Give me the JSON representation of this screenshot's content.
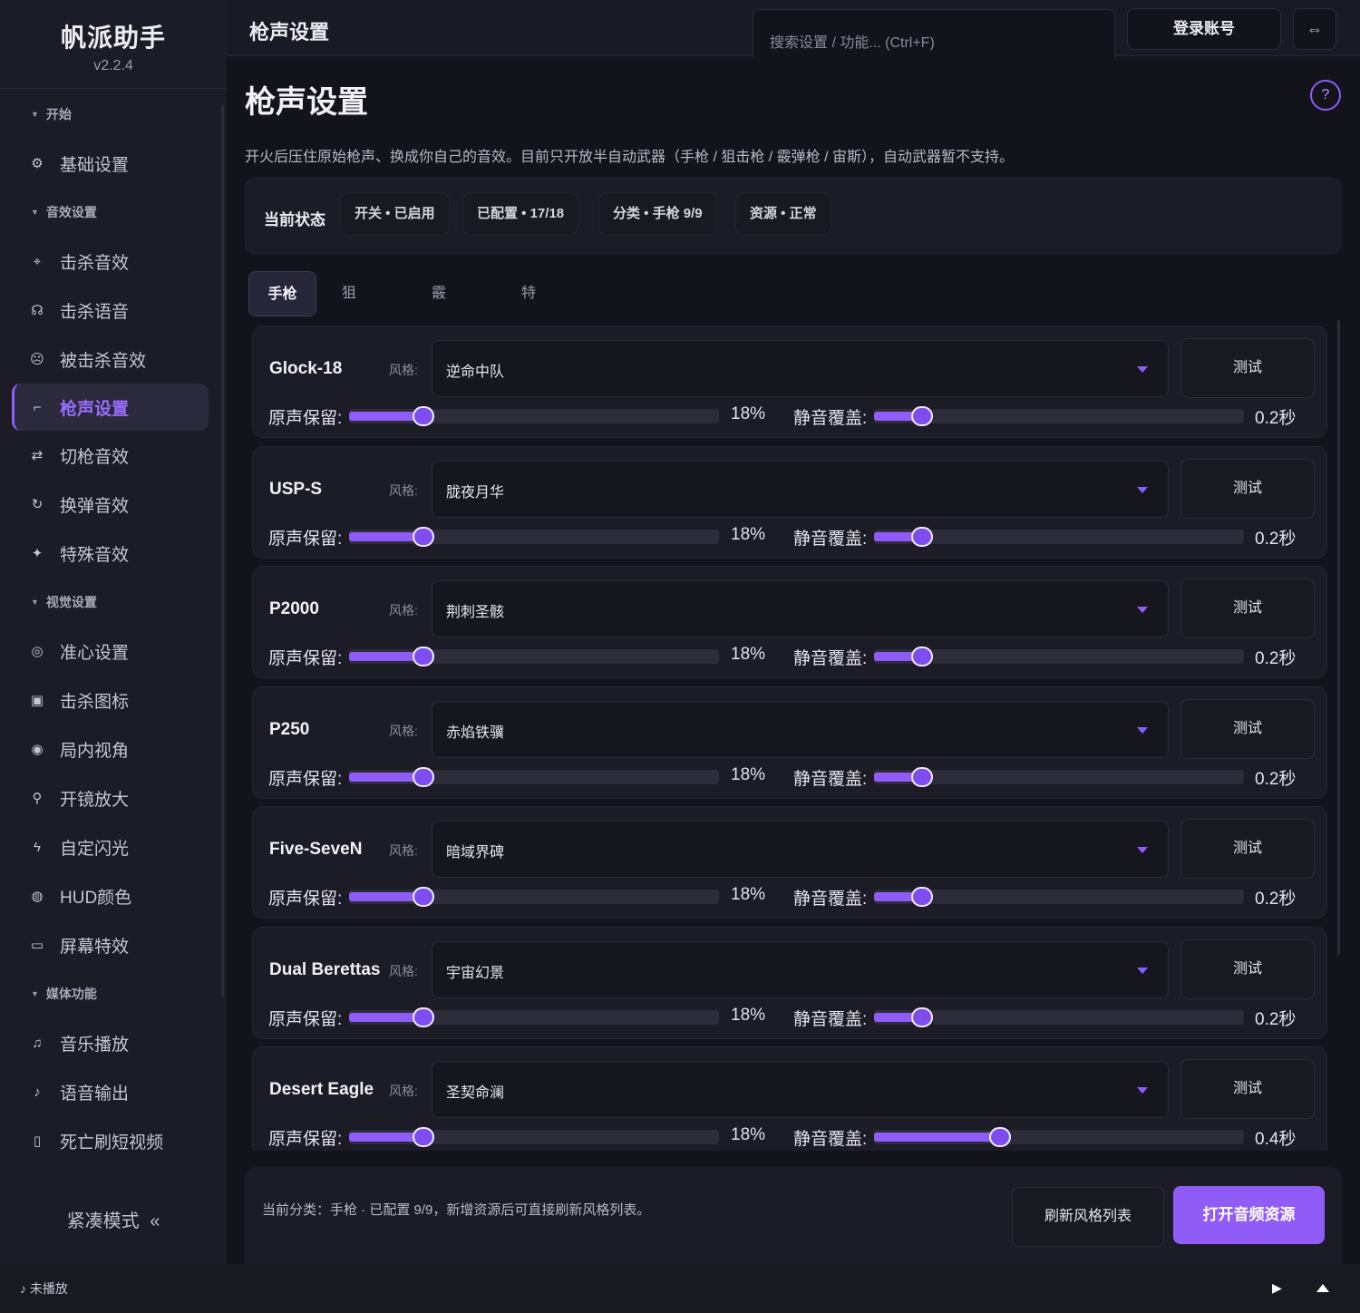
{
  "app": {
    "name": "帆派助手",
    "version": "v2.2.4"
  },
  "sidebar": {
    "groups": [
      {
        "label": "开始",
        "items": [
          {
            "label": "基础设置",
            "icon": "gear-icon"
          }
        ]
      },
      {
        "label": "音效设置",
        "items": [
          {
            "label": "击杀音效",
            "icon": "crosshair-icon"
          },
          {
            "label": "击杀语音",
            "icon": "voice-icon"
          },
          {
            "label": "被击杀音效",
            "icon": "skull-icon"
          },
          {
            "label": "枪声设置",
            "icon": "gun-icon",
            "active": true
          },
          {
            "label": "切枪音效",
            "icon": "swap-icon"
          },
          {
            "label": "换弹音效",
            "icon": "reload-icon"
          },
          {
            "label": "特殊音效",
            "icon": "star-icon"
          }
        ]
      },
      {
        "label": "视觉设置",
        "items": [
          {
            "label": "准心设置",
            "icon": "crosshair-circle-icon"
          },
          {
            "label": "击杀图标",
            "icon": "image-icon"
          },
          {
            "label": "局内视角",
            "icon": "eye-icon"
          },
          {
            "label": "开镜放大",
            "icon": "zoom-icon"
          },
          {
            "label": "自定闪光",
            "icon": "flash-icon"
          },
          {
            "label": "HUD颜色",
            "icon": "palette-icon"
          },
          {
            "label": "屏幕特效",
            "icon": "monitor-icon"
          }
        ]
      },
      {
        "label": "媒体功能",
        "items": [
          {
            "label": "音乐播放",
            "icon": "music-icon"
          },
          {
            "label": "语音输出",
            "icon": "mic-icon"
          },
          {
            "label": "死亡刷短视频",
            "icon": "phone-icon"
          }
        ]
      }
    ],
    "compact_label": "紧凑模式",
    "compact_icon": "«"
  },
  "topbar": {
    "title": "枪声设置",
    "search_placeholder": "搜索设置 / 功能... (Ctrl+F)",
    "login_label": "登录账号",
    "expand_icon": "⇔"
  },
  "page": {
    "title": "枪声设置",
    "help_icon": "?",
    "description": "开火后压住原始枪声、换成你自己的音效。目前只开放半自动武器（手枪 / 狙击枪 / 霰弹枪 / 宙斯），自动武器暂不支持。",
    "status_label": "当前状态",
    "chips": [
      "开关 • 已启用",
      "已配置 • 17/18",
      "分类 • 手枪 9/9",
      "资源 • 正常"
    ]
  },
  "tabs": [
    "手枪",
    "狙击枪",
    "霰弹枪",
    "特殊"
  ],
  "weapons_ui": {
    "style_label": "风格:",
    "test_label": "测试",
    "keep_label": "原声保留:",
    "mute_label": "静音覆盖:"
  },
  "weapons": [
    {
      "name": "Glock-18",
      "style": "逆命中队",
      "keep": "18%",
      "keep_level": 0.2,
      "mute": "0.2秒",
      "mute_level": 0.13
    },
    {
      "name": "USP-S",
      "style": "胧夜月华",
      "keep": "18%",
      "keep_level": 0.2,
      "mute": "0.2秒",
      "mute_level": 0.13
    },
    {
      "name": "P2000",
      "style": "荆刺圣骸",
      "keep": "18%",
      "keep_level": 0.2,
      "mute": "0.2秒",
      "mute_level": 0.13
    },
    {
      "name": "P250",
      "style": "赤焰铁骥",
      "keep": "18%",
      "keep_level": 0.2,
      "mute": "0.2秒",
      "mute_level": 0.13
    },
    {
      "name": "Five-SeveN",
      "style": "暗域界碑",
      "keep": "18%",
      "keep_level": 0.2,
      "mute": "0.2秒",
      "mute_level": 0.13
    },
    {
      "name": "Dual Berettas",
      "style": "宇宙幻景",
      "keep": "18%",
      "keep_level": 0.2,
      "mute": "0.2秒",
      "mute_level": 0.13
    },
    {
      "name": "Desert Eagle",
      "style": "圣契命澜",
      "keep": "18%",
      "keep_level": 0.2,
      "mute": "0.4秒",
      "mute_level": 0.34
    }
  ],
  "footer": {
    "info": "当前分类：手枪 · 已配置 9/9，新增资源后可直接刷新风格列表。",
    "refresh_label": "刷新风格列表",
    "open_label": "打开音频资源"
  },
  "player": {
    "status": "♪ 未播放"
  },
  "colors": {
    "accent": "#8f5cf7",
    "background": "#13131b",
    "panel": "#1c1c27"
  }
}
